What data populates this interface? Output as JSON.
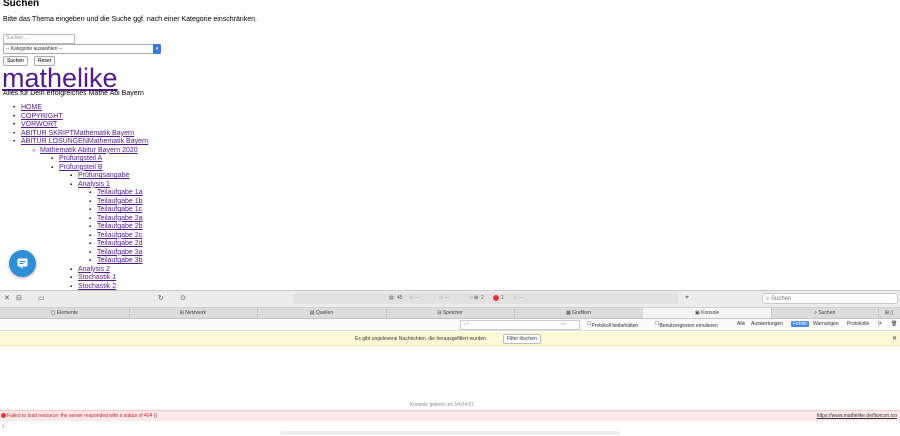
{
  "search": {
    "heading": "Suchen",
    "description": "Bitte das Thema eingeben und die Suche ggf. nach einer Kategorie einschränken.",
    "input_placeholder": "Suchen ...",
    "category_select": "-- Kategorie auswählen --",
    "submit_label": "Suchen",
    "reset_label": "Reset"
  },
  "site": {
    "title": "mathelike",
    "tagline": "Alles für Dein erfolgreiches Mathe Abi Bayern"
  },
  "nav": {
    "items": [
      {
        "label": "HOME",
        "level": 1
      },
      {
        "label": "COPYRIGHT",
        "level": 1
      },
      {
        "label": "VORWORT",
        "level": 1
      },
      {
        "label": "ABITUR SKRIPTMathematik Bayern",
        "level": 1
      },
      {
        "label": "ABITUR LÖSUNGENMathematik Bayern",
        "level": 1
      },
      {
        "label": "Mathematik Abitur Bayern 2020",
        "level": 2
      },
      {
        "label": "Prüfungsteil A",
        "level": 3
      },
      {
        "label": "Prüfungsteil B",
        "level": 3
      },
      {
        "label": "Prüfungsangabe",
        "level": 4
      },
      {
        "label": "Analysis 1",
        "level": 4
      },
      {
        "label": "Teilaufgabe 1a",
        "level": 5
      },
      {
        "label": "Teilaufgabe 1b",
        "level": 5
      },
      {
        "label": "Teilaufgabe 1c",
        "level": 5
      },
      {
        "label": "Teilaufgabe 2a",
        "level": 5
      },
      {
        "label": "Teilaufgabe 2b",
        "level": 5
      },
      {
        "label": "Teilaufgabe 2c",
        "level": 5
      },
      {
        "label": "Teilaufgabe 2d",
        "level": 5
      },
      {
        "label": "Teilaufgabe 3a",
        "level": 5
      },
      {
        "label": "Teilaufgabe 3b",
        "level": 5
      },
      {
        "label": "Analysis 2",
        "level": 4
      },
      {
        "label": "Stochastik 1",
        "level": 4
      },
      {
        "label": "Stochastik 2",
        "level": 4
      }
    ]
  },
  "devtools": {
    "toolbar": {
      "resources_count": "45",
      "warnings_count": "2",
      "errors_count": "1",
      "search_placeholder": "Suchen"
    },
    "tabs": [
      "Elemente",
      "Netzwerk",
      "Quellen",
      "Speicher",
      "Grafiken",
      "Konsole",
      "Suchen"
    ],
    "active_tab": "Konsole",
    "filter": {
      "preserve_log": "Protokoll beibehalten",
      "user_agent": "Benutzergesten emulieren",
      "levels": [
        "Alle",
        "Auswertungen",
        "Fehler",
        "Warnungen",
        "Protokolle"
      ],
      "active_level": "Fehler"
    },
    "banner": {
      "text": "Es gibt ungelesene Nachrichten, die herausgefiltert wurden",
      "button": "Filter löschen"
    },
    "cleared_text": "Konsole geleert um 14:04:57",
    "error": {
      "message": "Failed to load resource: the server responded with a status of 404 ()",
      "source": "https://www.mathelike.de/favicon.ico"
    },
    "prompt": "›"
  },
  "colors": {
    "link": "#551a8b",
    "chat_button": "#2f8fd6",
    "error_text": "#c0252b",
    "warning_bg": "#fff8d6",
    "active_filter": "#4a8be6"
  }
}
